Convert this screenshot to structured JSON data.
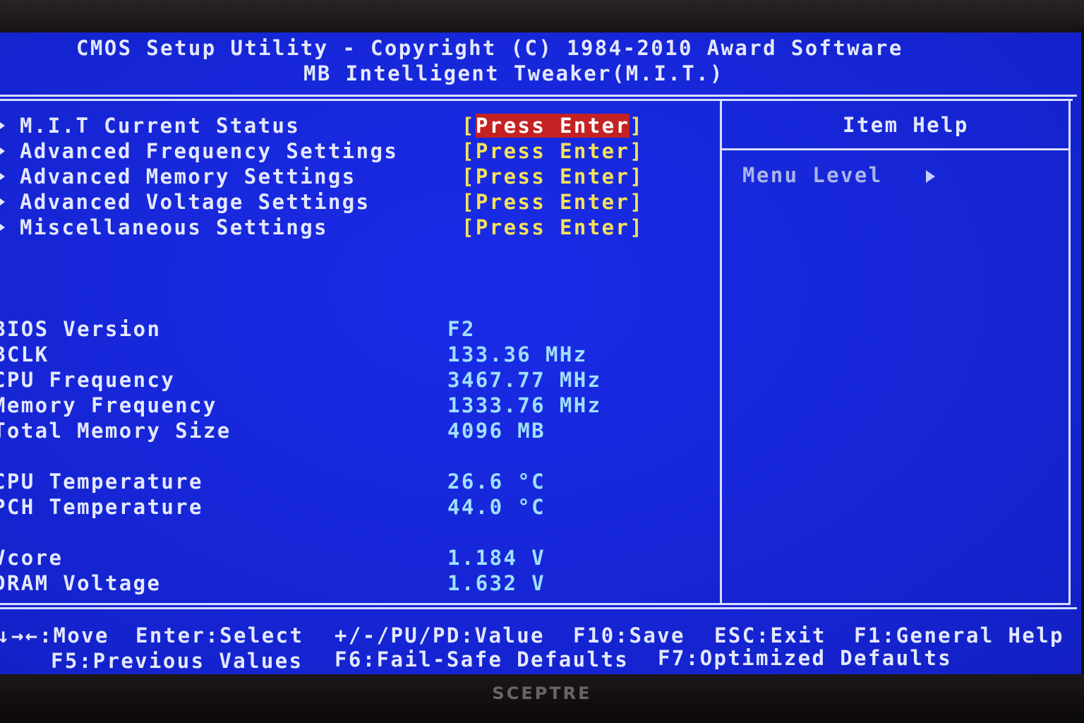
{
  "header": {
    "line1": "CMOS Setup Utility - Copyright (C) 1984-2010 Award Software",
    "line2": "MB Intelligent Tweaker(M.I.T.)"
  },
  "menu": [
    {
      "label": "M.I.T Current Status",
      "action": "Press Enter",
      "selected": true
    },
    {
      "label": "Advanced Frequency Settings",
      "action": "Press Enter"
    },
    {
      "label": "Advanced Memory Settings",
      "action": "Press Enter"
    },
    {
      "label": "Advanced Voltage Settings",
      "action": "Press Enter"
    },
    {
      "label": "Miscellaneous Settings",
      "action": "Press Enter"
    }
  ],
  "info": [
    {
      "label": "BIOS Version",
      "value": "F2"
    },
    {
      "label": "BCLK",
      "value": "133.36 MHz"
    },
    {
      "label": "CPU Frequency",
      "value": "3467.77 MHz"
    },
    {
      "label": "Memory Frequency",
      "value": "1333.76 MHz"
    },
    {
      "label": "Total Memory Size",
      "value": "4096 MB"
    },
    {
      "label": "CPU Temperature",
      "value": "26.6 °C"
    },
    {
      "label": "PCH Temperature",
      "value": "44.0 °C"
    },
    {
      "label": "Vcore",
      "value": "1.184 V"
    },
    {
      "label": "DRAM Voltage",
      "value": "1.632 V"
    }
  ],
  "help": {
    "title": "Item Help",
    "menu_level": "Menu Level",
    "icon": "triangle-right-icon"
  },
  "footer": {
    "row1": [
      {
        "key": "↓→←:",
        "desc": "Move"
      },
      {
        "key": "Enter:",
        "desc": "Select"
      },
      {
        "key": "+/-/PU/PD:",
        "desc": "Value"
      },
      {
        "key": "F10:",
        "desc": "Save"
      },
      {
        "key": "ESC:",
        "desc": "Exit"
      },
      {
        "key": "F1:",
        "desc": "General Help"
      }
    ],
    "row2": [
      {
        "key": "F5:",
        "desc": "Previous Values"
      },
      {
        "key": "F6:",
        "desc": "Fail-Safe Defaults"
      },
      {
        "key": "F7:",
        "desc": "Optimized Defaults"
      }
    ]
  },
  "monitor": {
    "brand": "SCEPTRE"
  },
  "colors": {
    "background": "#1626d6",
    "text": "#e4e8ff",
    "value": "#9fe0ff",
    "action": "#f4e25a",
    "highlight": "#c42222"
  }
}
